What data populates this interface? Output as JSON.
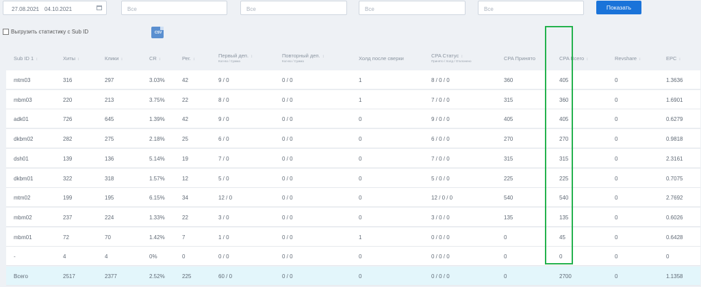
{
  "filters": {
    "date_from": "27.08.2021",
    "date_sep": "–",
    "date_to": "04.10.2021",
    "select1": "Все",
    "select2": "Все",
    "select3": "Все",
    "select4": "Все",
    "show_button": "Показать"
  },
  "export": {
    "checkbox_label": "Выгрузить статистику с Sub ID",
    "csv_label": "CSV"
  },
  "table": {
    "headers": [
      {
        "label": "Sub ID 1",
        "sub": ""
      },
      {
        "label": "Хиты",
        "sub": ""
      },
      {
        "label": "Клики",
        "sub": ""
      },
      {
        "label": "CR",
        "sub": ""
      },
      {
        "label": "Рег.",
        "sub": ""
      },
      {
        "label": "Первый деп.",
        "sub": "Кол-во / Сумма"
      },
      {
        "label": "Повторный деп.",
        "sub": "Кол-во / Сумма"
      },
      {
        "label": "Холд после сверки",
        "sub": ""
      },
      {
        "label": "CPA Статус",
        "sub": "Принято / Холд / Отклонено"
      },
      {
        "label": "CPA Принято",
        "sub": ""
      },
      {
        "label": "CPA Всего",
        "sub": ""
      },
      {
        "label": "Revshare",
        "sub": ""
      },
      {
        "label": "EPC",
        "sub": ""
      }
    ],
    "sort_icon": "↕",
    "rows": [
      [
        "mtm03",
        "316",
        "297",
        "3.03%",
        "42",
        "9 / 0",
        "0 / 0",
        "1",
        "8 / 0 / 0",
        "360",
        "405",
        "0",
        "1.3636"
      ],
      [
        "mbm03",
        "220",
        "213",
        "3.75%",
        "22",
        "8 / 0",
        "0 / 0",
        "1",
        "7 / 0 / 0",
        "315",
        "360",
        "0",
        "1.6901"
      ],
      [
        "adk01",
        "726",
        "645",
        "1.39%",
        "42",
        "9 / 0",
        "0 / 0",
        "0",
        "9 / 0 / 0",
        "405",
        "405",
        "0",
        "0.6279"
      ],
      [
        "dkbm02",
        "282",
        "275",
        "2.18%",
        "25",
        "6 / 0",
        "0 / 0",
        "0",
        "6 / 0 / 0",
        "270",
        "270",
        "0",
        "0.9818"
      ],
      [
        "dsh01",
        "139",
        "136",
        "5.14%",
        "19",
        "7 / 0",
        "0 / 0",
        "0",
        "7 / 0 / 0",
        "315",
        "315",
        "0",
        "2.3161"
      ],
      [
        "dkbm01",
        "322",
        "318",
        "1.57%",
        "12",
        "5 / 0",
        "0 / 0",
        "0",
        "5 / 0 / 0",
        "225",
        "225",
        "0",
        "0.7075"
      ],
      [
        "mtm02",
        "199",
        "195",
        "6.15%",
        "34",
        "12 / 0",
        "0 / 0",
        "0",
        "12 / 0 / 0",
        "540",
        "540",
        "0",
        "2.7692"
      ],
      [
        "mbm02",
        "237",
        "224",
        "1.33%",
        "22",
        "3 / 0",
        "0 / 0",
        "0",
        "3 / 0 / 0",
        "135",
        "135",
        "0",
        "0.6026"
      ],
      [
        "mbm01",
        "72",
        "70",
        "1.42%",
        "7",
        "1 / 0",
        "0 / 0",
        "1",
        "0 / 0 / 0",
        "0",
        "45",
        "0",
        "0.6428"
      ],
      [
        "-",
        "4",
        "4",
        "0%",
        "0",
        "0 / 0",
        "0 / 0",
        "0",
        "0 / 0 / 0",
        "0",
        "0",
        "0",
        "0"
      ]
    ],
    "total": [
      "Всего",
      "2517",
      "2377",
      "2.52%",
      "225",
      "60 / 0",
      "0 / 0",
      "0",
      "0 / 0 / 0",
      "0",
      "2700",
      "0",
      "1.1358"
    ]
  },
  "colors": {
    "accent": "#1a73d9",
    "highlight": "#22b14c",
    "total_row": "#e3f6fb"
  }
}
